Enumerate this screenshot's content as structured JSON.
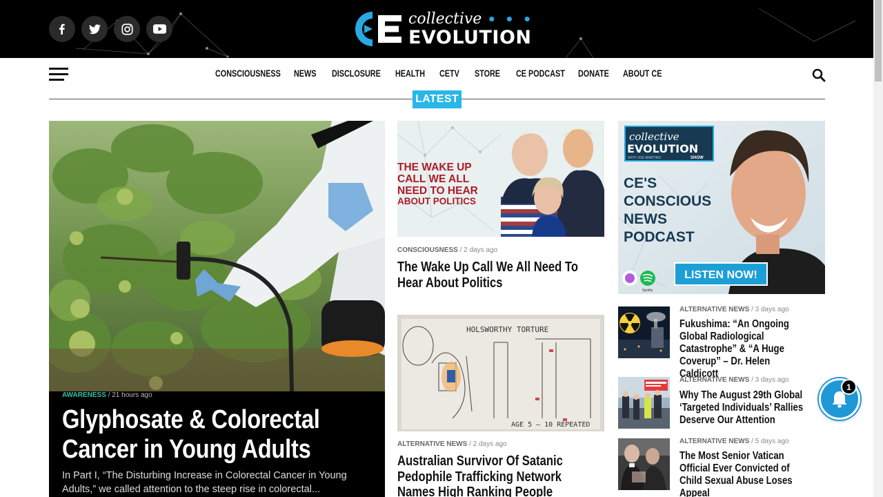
{
  "brand": {
    "logo_mark": "CE",
    "logo_top": "collective",
    "logo_dots": "• • •",
    "logo_bottom": "EVOLUTION"
  },
  "social": [
    {
      "name": "facebook-icon"
    },
    {
      "name": "twitter-icon"
    },
    {
      "name": "instagram-icon"
    },
    {
      "name": "youtube-icon"
    }
  ],
  "nav": {
    "items": [
      "CONSCIOUSNESS",
      "NEWS",
      "DISCLOSURE",
      "HEALTH",
      "CETV",
      "STORE",
      "CE PODCAST",
      "DONATE",
      "ABOUT CE"
    ],
    "section_tag": "LATEST"
  },
  "feature": {
    "category": "AWARENESS",
    "time": "21 hours ago",
    "title": "Glyphosate & Colorectal Cancer in Young Adults",
    "excerpt": "In Part I, “The Disturbing Increase in Colorectal Cancer in Young Adults,” we called attention to the steep rise in colorectal..."
  },
  "middle": [
    {
      "category": "CONSCIOUSNESS",
      "time": "2 days ago",
      "title": "The Wake Up Call We All Need To Hear About Politics",
      "image_text": [
        "THE WAKE UP",
        "CALL WE ALL",
        "NEED TO HEAR",
        "ABOUT POLITICS"
      ]
    },
    {
      "category": "ALTERNATIVE NEWS",
      "time": "2 days ago",
      "title": "Australian Survivor Of Satanic Pedophile Trafficking Network Names High Ranking People",
      "image_text": [
        "HOLSWORTHY  TORTURE",
        "AGE 5 – 10   REPEATED"
      ]
    }
  ],
  "podcast": {
    "badge_top": "collective",
    "badge_main": "EVOLUTION",
    "badge_sub": "WITH JOE MARTINO",
    "badge_show": "SHOW",
    "headline": [
      "CE'S",
      "CONSCIOUS",
      "NEWS",
      "PODCAST"
    ],
    "cta": "LISTEN NOW!",
    "spotify": "Spotify"
  },
  "sidebar": [
    {
      "category": "ALTERNATIVE NEWS",
      "time": "3 days ago",
      "title": "Fukushima: “An Ongoing Global Radiological Catastrophe” & “A Huge Coverup” – Dr. Helen Caldicott"
    },
    {
      "category": "ALTERNATIVE NEWS",
      "time": "3 days ago",
      "title": "Why The August 29th Global ‘Targeted Individuals’ Rallies Deserve Our Attention"
    },
    {
      "category": "ALTERNATIVE NEWS",
      "time": "5 days ago",
      "title": "The Most Senior Vatican Official Ever Convicted of Child Sexual Abuse Loses Appeal"
    }
  ],
  "notification": {
    "count": "1"
  },
  "colors": {
    "accent": "#29b6e8",
    "feature_category": "#2ec4a6",
    "header_bg": "#000000"
  }
}
